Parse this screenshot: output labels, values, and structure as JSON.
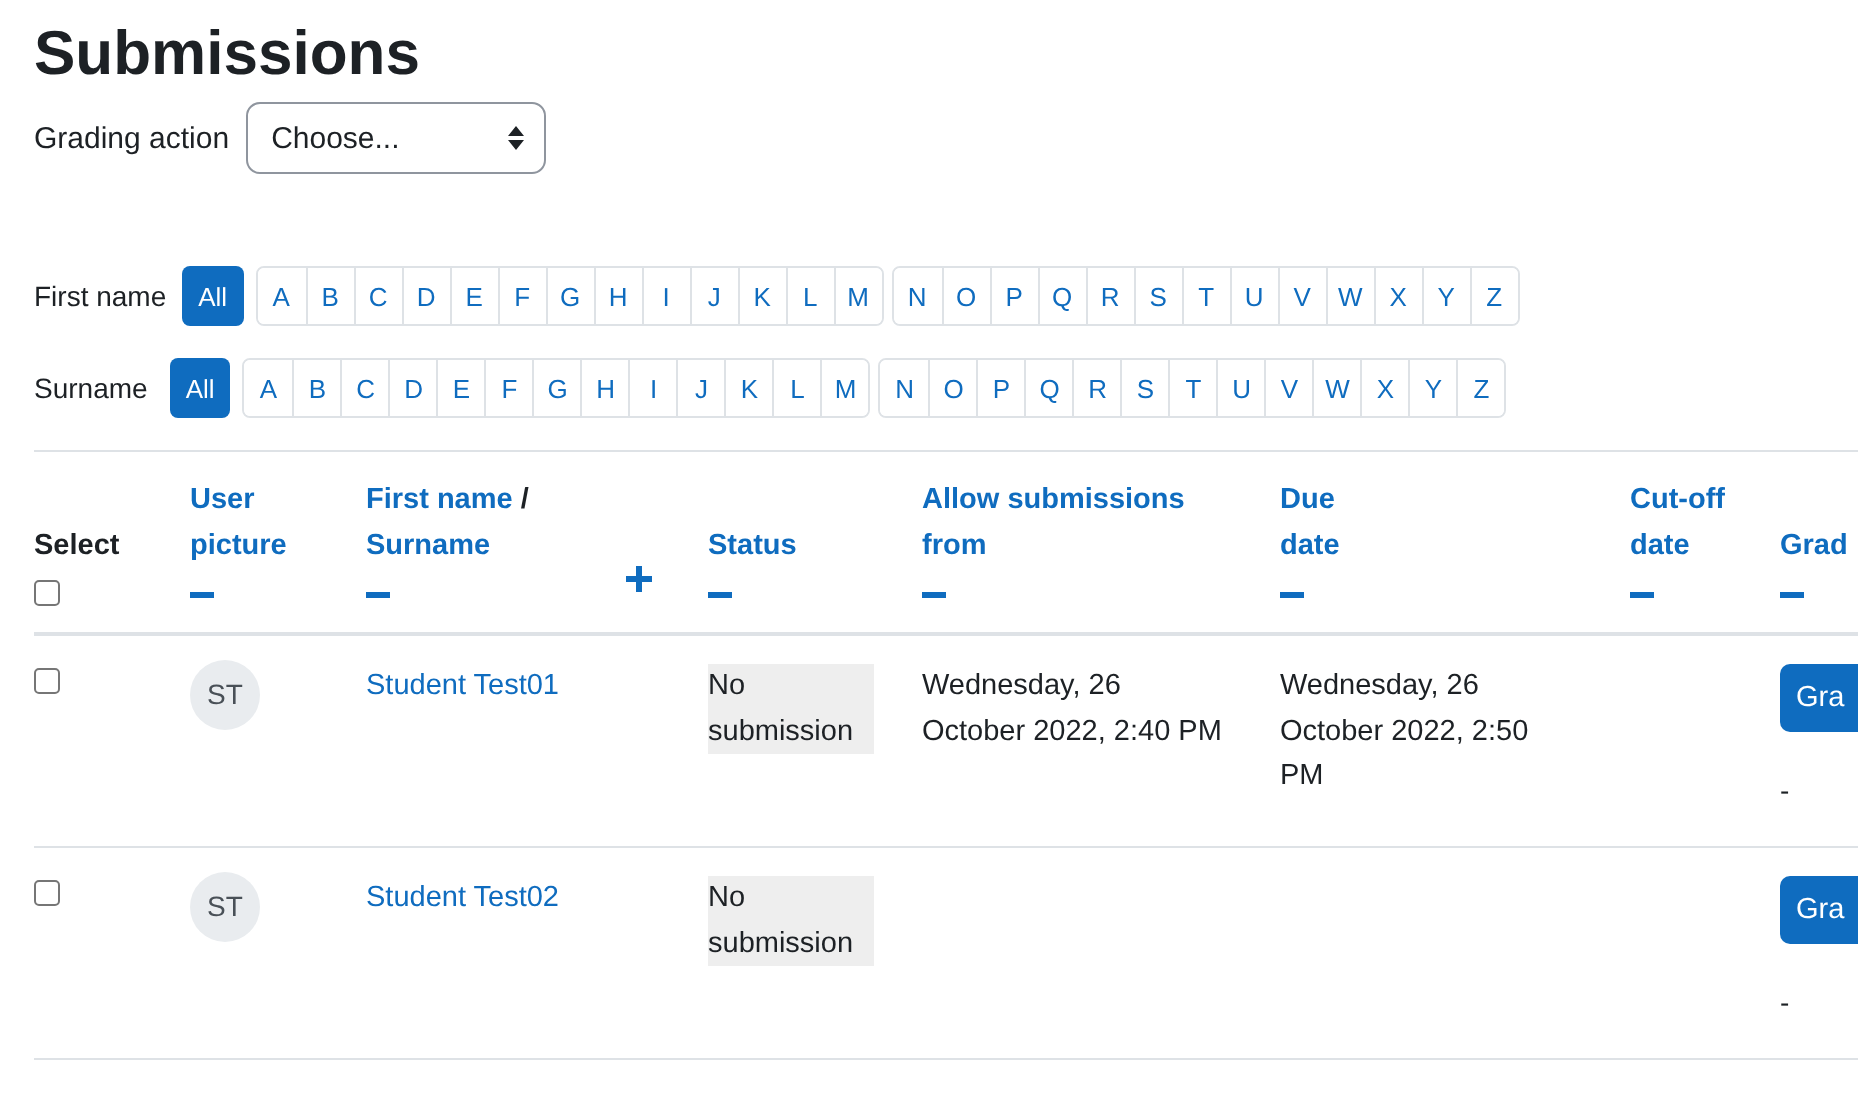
{
  "title": "Submissions",
  "grading_action": {
    "label": "Grading action",
    "value": "Choose..."
  },
  "filters": [
    {
      "label": "First name",
      "groups": [
        [
          {
            "label": "All",
            "selected": true
          }
        ],
        [
          {
            "label": "A",
            "selected": false
          },
          {
            "label": "B",
            "selected": false
          },
          {
            "label": "C",
            "selected": false
          },
          {
            "label": "D",
            "selected": false
          },
          {
            "label": "E",
            "selected": false
          },
          {
            "label": "F",
            "selected": false
          },
          {
            "label": "G",
            "selected": false
          },
          {
            "label": "H",
            "selected": false
          },
          {
            "label": "I",
            "selected": false
          },
          {
            "label": "J",
            "selected": false
          },
          {
            "label": "K",
            "selected": false
          },
          {
            "label": "L",
            "selected": false
          },
          {
            "label": "M",
            "selected": false
          }
        ],
        [
          {
            "label": "N",
            "selected": false
          },
          {
            "label": "O",
            "selected": false
          },
          {
            "label": "P",
            "selected": false
          },
          {
            "label": "Q",
            "selected": false
          },
          {
            "label": "R",
            "selected": false
          },
          {
            "label": "S",
            "selected": false
          },
          {
            "label": "T",
            "selected": false
          },
          {
            "label": "U",
            "selected": false
          },
          {
            "label": "V",
            "selected": false
          },
          {
            "label": "W",
            "selected": false
          },
          {
            "label": "X",
            "selected": false
          },
          {
            "label": "Y",
            "selected": false
          },
          {
            "label": "Z",
            "selected": false
          }
        ]
      ]
    },
    {
      "label": "Surname",
      "groups": [
        [
          {
            "label": "All",
            "selected": true
          }
        ],
        [
          {
            "label": "A",
            "selected": false
          },
          {
            "label": "B",
            "selected": false
          },
          {
            "label": "C",
            "selected": false
          },
          {
            "label": "D",
            "selected": false
          },
          {
            "label": "E",
            "selected": false
          },
          {
            "label": "F",
            "selected": false
          },
          {
            "label": "G",
            "selected": false
          },
          {
            "label": "H",
            "selected": false
          },
          {
            "label": "I",
            "selected": false
          },
          {
            "label": "J",
            "selected": false
          },
          {
            "label": "K",
            "selected": false
          },
          {
            "label": "L",
            "selected": false
          },
          {
            "label": "M",
            "selected": false
          }
        ],
        [
          {
            "label": "N",
            "selected": false
          },
          {
            "label": "O",
            "selected": false
          },
          {
            "label": "P",
            "selected": false
          },
          {
            "label": "Q",
            "selected": false
          },
          {
            "label": "R",
            "selected": false
          },
          {
            "label": "S",
            "selected": false
          },
          {
            "label": "T",
            "selected": false
          },
          {
            "label": "U",
            "selected": false
          },
          {
            "label": "V",
            "selected": false
          },
          {
            "label": "W",
            "selected": false
          },
          {
            "label": "X",
            "selected": false
          },
          {
            "label": "Y",
            "selected": false
          },
          {
            "label": "Z",
            "selected": false
          }
        ]
      ]
    }
  ],
  "columns": [
    {
      "kind": "select",
      "label": "Select",
      "checked": false
    },
    {
      "kind": "sort",
      "links": [
        "User picture"
      ]
    },
    {
      "kind": "sort",
      "links": [
        "First name",
        "Surname"
      ],
      "separator": "/"
    },
    {
      "kind": "collapsed"
    },
    {
      "kind": "sort",
      "links": [
        "Status"
      ]
    },
    {
      "kind": "sort",
      "links": [
        "Allow submissions from"
      ]
    },
    {
      "kind": "sort",
      "links": [
        "Due date"
      ]
    },
    {
      "kind": "sort",
      "links": [
        "Cut-off date"
      ]
    },
    {
      "kind": "sort",
      "links": [
        "Grad"
      ]
    }
  ],
  "rows": [
    {
      "checked": false,
      "initials": "ST",
      "name": "Student Test01",
      "status": "No submission",
      "allow_from": "Wednesday, 26 October 2022, 2:40 PM",
      "due": "Wednesday, 26 October 2022, 2:50 PM",
      "grade_button": "Gra",
      "grade": "-"
    },
    {
      "checked": false,
      "initials": "ST",
      "name": "Student Test02",
      "status": "No submission",
      "allow_from": "",
      "due": "",
      "grade_button": "Gra",
      "grade": "-"
    }
  ]
}
